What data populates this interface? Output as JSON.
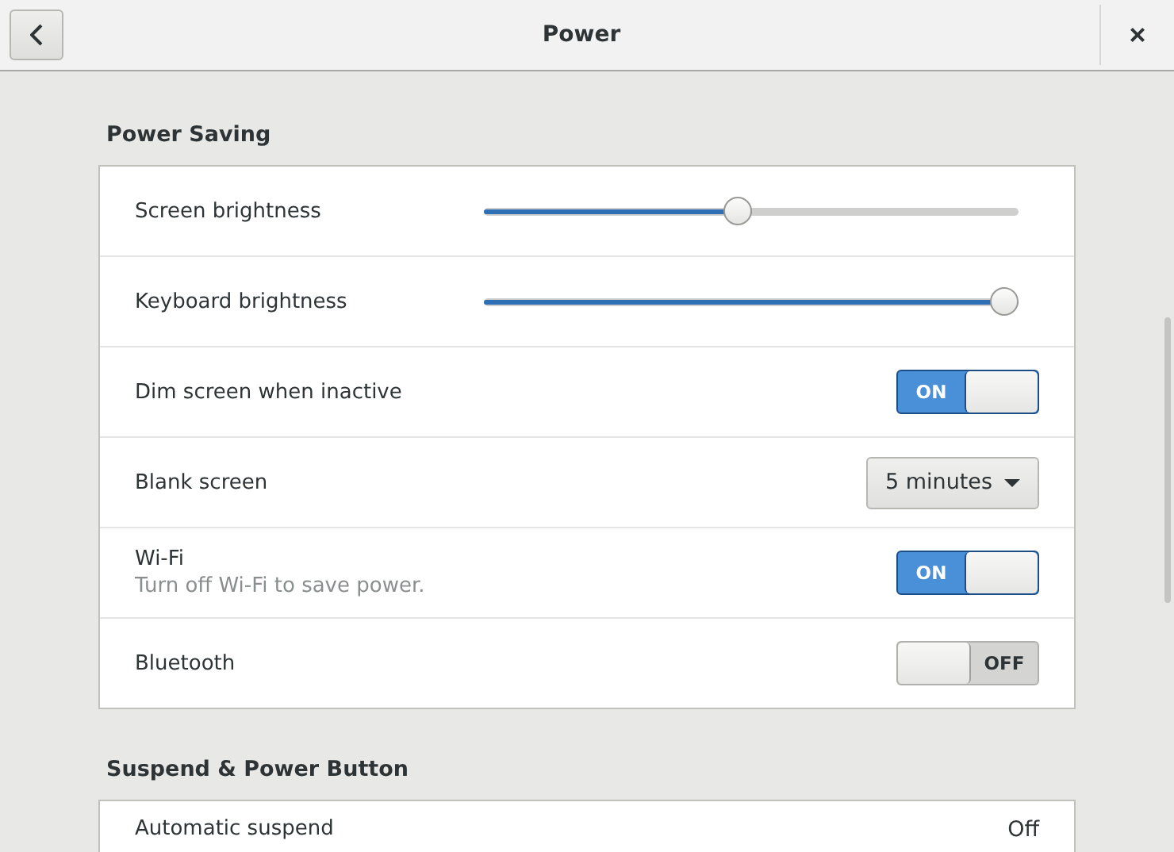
{
  "window": {
    "title": "Power",
    "close": "×"
  },
  "sections": [
    {
      "title": "Power Saving",
      "rows": [
        {
          "kind": "slider",
          "label": "Screen brightness",
          "level": 0.5
        },
        {
          "kind": "slider",
          "label": "Keyboard brightness",
          "level": 1.0
        },
        {
          "kind": "switch",
          "label": "Dim screen when inactive",
          "on": true,
          "text": "ON"
        },
        {
          "kind": "dropdown",
          "label": "Blank screen",
          "value": "5 minutes"
        },
        {
          "kind": "switch",
          "label": "Wi-Fi",
          "subtitle": "Turn off Wi-Fi to save power.",
          "on": true,
          "text": "ON"
        },
        {
          "kind": "switch",
          "label": "Bluetooth",
          "on": false,
          "text": "OFF"
        }
      ]
    },
    {
      "title": "Suspend & Power Button",
      "rows": [
        {
          "kind": "value",
          "label": "Automatic suspend",
          "value": "Off"
        }
      ]
    }
  ]
}
